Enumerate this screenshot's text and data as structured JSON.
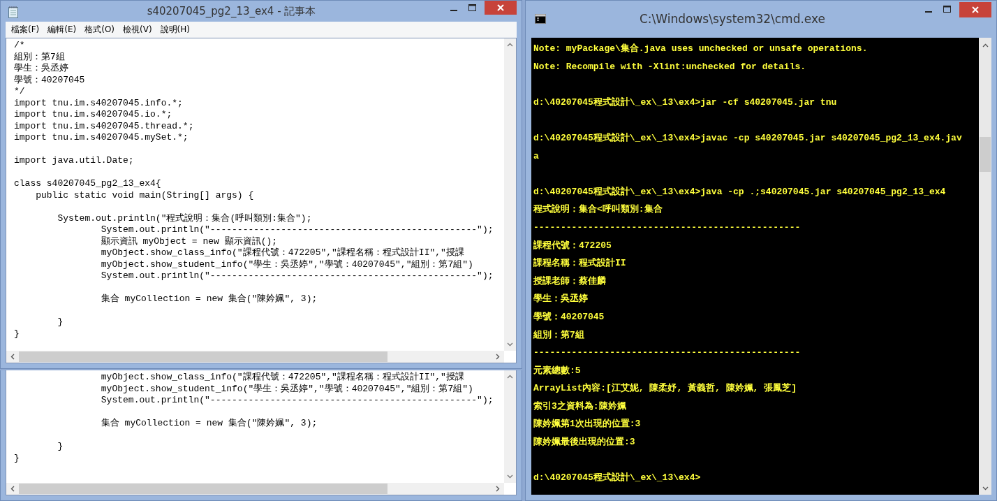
{
  "notepad": {
    "title": "s40207045_pg2_13_ex4 - 記事本",
    "menu": [
      "檔案(F)",
      "編輯(E)",
      "格式(O)",
      "檢視(V)",
      "說明(H)"
    ],
    "blocks": [
      [
        "/*",
        "組別：第7組",
        "學生：吳丞婷",
        "學號：40207045",
        "*/",
        "import tnu.im.s40207045.info.*;",
        "import tnu.im.s40207045.io.*;",
        "import tnu.im.s40207045.thread.*;",
        "import tnu.im.s40207045.mySet.*;"
      ],
      [
        "import java.util.Date;"
      ],
      [
        "class s40207045_pg2_13_ex4{",
        "    public static void main(String[] args) {"
      ],
      [
        "        System.out.println(\"程式說明：集合(呼叫類別:集合\");",
        "                System.out.println(\"-------------------------------------------------\");",
        "                顯示資訊 myObject = new 顯示資訊();",
        "                myObject.show_class_info(\"課程代號：472205\",\"課程名稱：程式設計II\",\"授課",
        "                myObject.show_student_info(\"學生：吳丞婷\",\"學號：40207045\",\"組別：第7組\")",
        "                System.out.println(\"-------------------------------------------------\");"
      ],
      [
        "                集合 myCollection = new 集合(\"陳妗姵\", 3);"
      ],
      [
        "        }",
        "}"
      ]
    ]
  },
  "background_window": {
    "blocks": [
      [
        "                myObject.show_class_info(\"課程代號：472205\",\"課程名稱：程式設計II\",\"授課",
        "                myObject.show_student_info(\"學生：吳丞婷\",\"學號：40207045\",\"組別：第7組\")",
        "                System.out.println(\"-------------------------------------------------\");"
      ],
      [
        "                集合 myCollection = new 集合(\"陳妗姵\", 3);"
      ],
      [
        "        }",
        "}"
      ]
    ]
  },
  "console": {
    "title": "C:\\Windows\\system32\\cmd.exe",
    "blocks": [
      [
        "Note: myPackage\\集合.java uses unchecked or unsafe operations.",
        "Note: Recompile with -Xlint:unchecked for details."
      ],
      [
        "d:\\40207045程式設計\\_ex\\_13\\ex4>jar -cf s40207045.jar tnu"
      ],
      [
        "d:\\40207045程式設計\\_ex\\_13\\ex4>javac -cp s40207045.jar s40207045_pg2_13_ex4.jav",
        "a"
      ],
      [
        "d:\\40207045程式設計\\_ex\\_13\\ex4>java -cp .;s40207045.jar s40207045_pg2_13_ex4",
        "程式說明：集合<呼叫類別:集合",
        "-------------------------------------------------",
        "課程代號：472205",
        "課程名稱：程式設計II",
        "授課老師：蔡佳麟",
        "學生：吳丞婷",
        "學號：40207045",
        "組別：第7組",
        "-------------------------------------------------",
        "元素總數:5",
        "ArrayList內容:[江艾妮, 陳柔妤, 黃義哲, 陳妗姵, 張鳳芝]",
        "索引3之資料為:陳妗姵",
        "陳妗姵第1次出現的位置:3",
        "陳妗姵最後出現的位置:3"
      ],
      [
        "d:\\40207045程式設計\\_ex\\_13\\ex4>"
      ]
    ]
  }
}
